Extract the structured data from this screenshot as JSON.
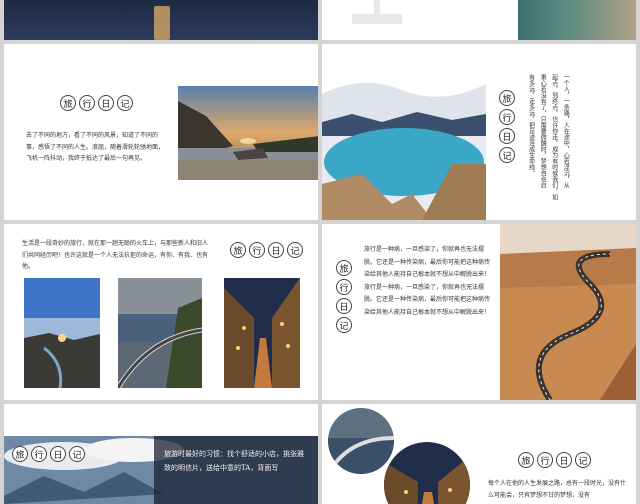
{
  "slides": {
    "top_left": {
      "label": ""
    },
    "s1": {
      "title_chars": [
        "旅",
        "行",
        "日",
        "记"
      ],
      "text": "去了不同的地方，看了不同的风景，知道了不同的事，感悟了不同的人生。浪屈，随着滑轮轮驰地面，飞机一阵抖动，我终于抵达了最后一句再见。"
    },
    "s2": {
      "title_chars": [
        "旅",
        "行",
        "日",
        "记"
      ],
      "columns": [
        "一个人，一条路，人在途中，心若浮沉，从",
        "起点，到终点，也许你走，成为有时候我们，如",
        "果心若没有了，只需要微醺时，梦想自会启",
        "有多远，走多远，把足迹连成生命线。"
      ]
    },
    "s3": {
      "title_chars": [
        "旅",
        "行",
        "日",
        "记"
      ],
      "text": "生活是一段奇妙的旅行，就在那一趟无聪的火车上，与那些新人和旧人们共同经历吧！也许这就是一个人无法抗拒的命运，有你、有我、也有他。"
    },
    "s4": {
      "title_chars": [
        "旅",
        "行",
        "日",
        "记"
      ],
      "text": "旅行是一种病，一旦感染了，你就再也无法摆脱。它还是一种传染病，最后你可能把这种病传染给其他人能持自己根本就不想从中解脱出来！旅行是一种病，一旦感染了，你就再也无法摆脱。它还是一种传染病，最后你可能把这种病传染给其他人能持自己根本就不想从中解脱出来！"
    },
    "s5": {
      "title_chars": [
        "旅",
        "行",
        "日",
        "记"
      ],
      "text": "旅游时最好的习惯：找个舒适的小店，挑张雅致的明信片，送给中意的TA，背面写"
    },
    "s6": {
      "title_chars": [
        "旅",
        "行",
        "日",
        "记"
      ],
      "text": "每个人在他的人生发展之路，总有一段时光，没有什么可能会，只有梦想不甘的梦想，没有"
    }
  },
  "colors": {
    "accent": "#2b4a7a",
    "line": "#444444"
  }
}
